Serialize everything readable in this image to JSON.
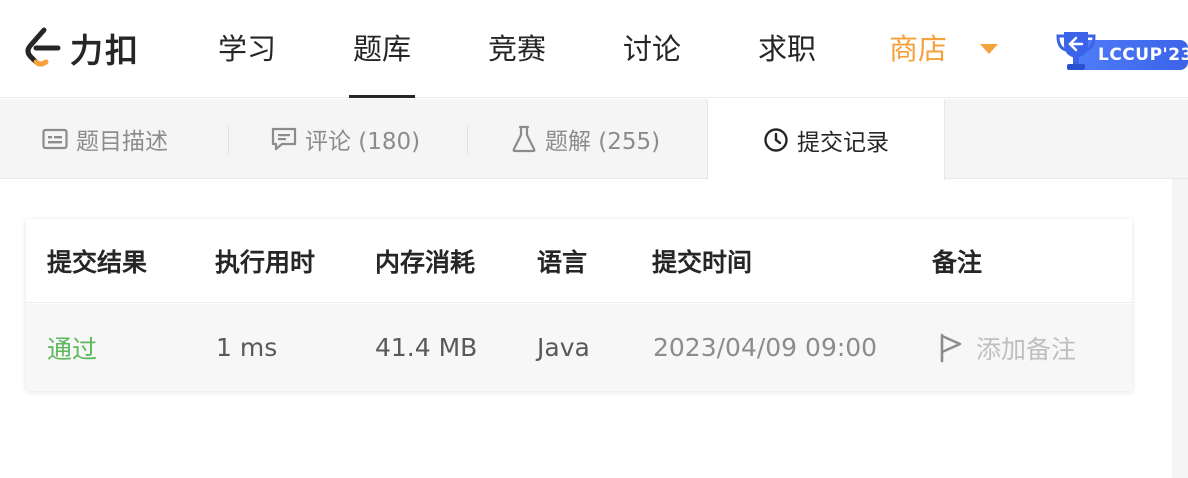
{
  "brand": {
    "name": "力扣"
  },
  "nav": {
    "items": [
      "学习",
      "题库",
      "竞赛",
      "讨论",
      "求职"
    ],
    "active": "题库",
    "store": "商店",
    "badge": "LCCUP'23"
  },
  "tabs": [
    {
      "label": "题目描述",
      "icon": "description-icon"
    },
    {
      "label": "评论 (180)",
      "icon": "comment-icon"
    },
    {
      "label": "题解 (255)",
      "icon": "flask-icon"
    },
    {
      "label": "提交记录",
      "icon": "clock-icon",
      "active": true
    }
  ],
  "submissions": {
    "headers": [
      "提交结果",
      "执行用时",
      "内存消耗",
      "语言",
      "提交时间",
      "备注"
    ],
    "rows": [
      {
        "status": "通过",
        "runtime": "1 ms",
        "memory": "41.4 MB",
        "language": "Java",
        "time": "2023/04/09 09:00",
        "note": "添加备注"
      }
    ]
  },
  "colors": {
    "accepted": "#5cb85c",
    "store": "#f5a13c",
    "badge": "#4e7cf7"
  }
}
